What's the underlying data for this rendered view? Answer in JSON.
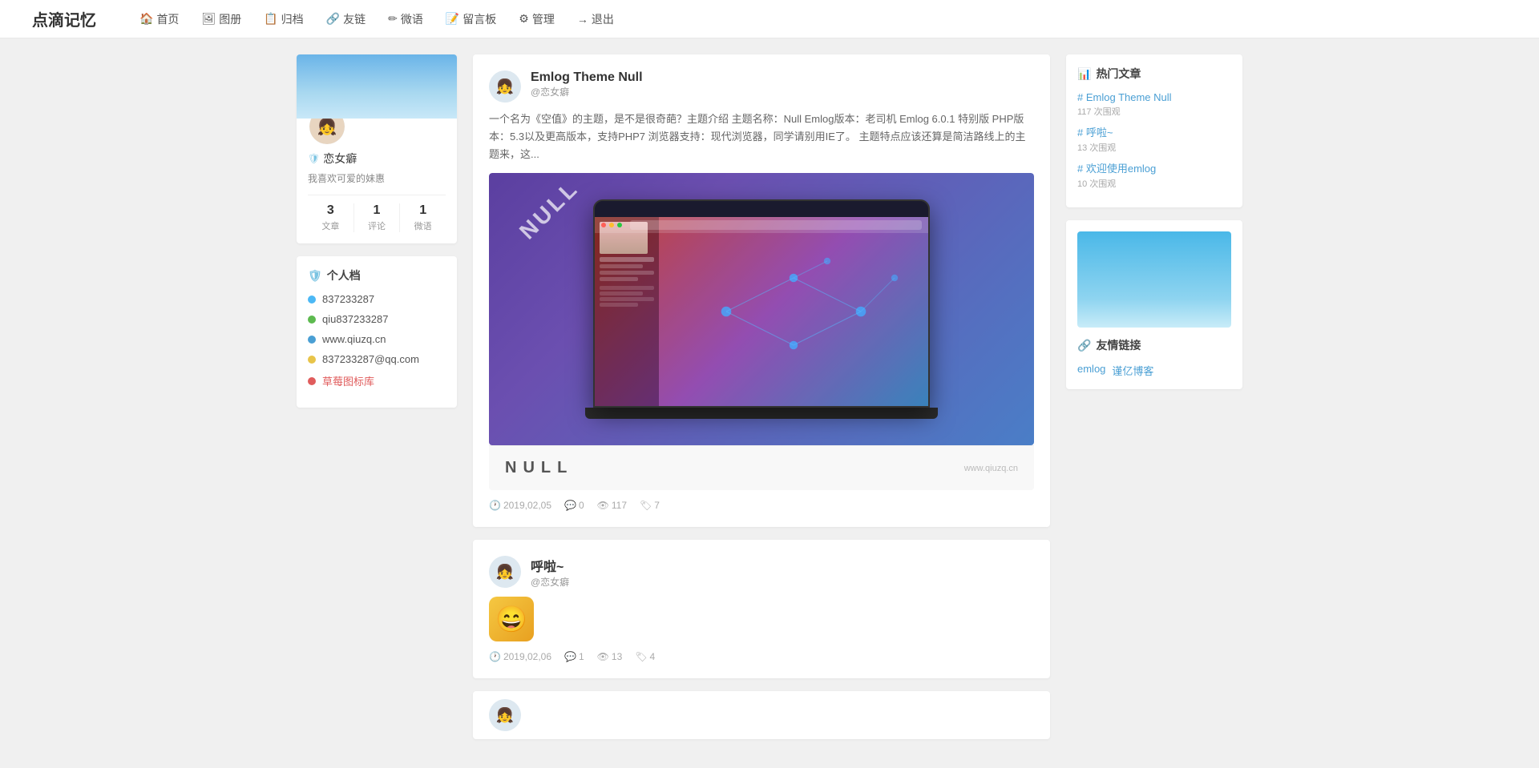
{
  "brand": "点滴记忆",
  "nav": {
    "items": [
      {
        "label": "首页",
        "icon": "🏠",
        "href": "#"
      },
      {
        "label": "图册",
        "icon": "🖼",
        "href": "#"
      },
      {
        "label": "归档",
        "icon": "📋",
        "href": "#"
      },
      {
        "label": "友链",
        "icon": "🔗",
        "href": "#"
      },
      {
        "label": "微语",
        "icon": "✏",
        "href": "#"
      },
      {
        "label": "留言板",
        "icon": "📝",
        "href": "#"
      },
      {
        "label": "管理",
        "icon": "⚙",
        "href": "#"
      },
      {
        "label": "退出",
        "icon": "→",
        "href": "#"
      }
    ]
  },
  "profile": {
    "name": "恋女癖",
    "desc": "我喜欢可爱的妹惠",
    "stats": [
      {
        "num": "3",
        "label": "文章"
      },
      {
        "num": "1",
        "label": "评论"
      },
      {
        "num": "1",
        "label": "微语"
      }
    ]
  },
  "personal": {
    "title": "个人档",
    "items": [
      {
        "type": "qq",
        "text": "837233287"
      },
      {
        "type": "wechat",
        "text": "qiu837233287"
      },
      {
        "type": "home",
        "text": "www.qiuzq.cn"
      },
      {
        "type": "email",
        "text": "837233287@qq.com"
      },
      {
        "type": "link",
        "text": "草莓图标库"
      }
    ]
  },
  "articles": [
    {
      "id": 1,
      "title": "Emlog Theme Null",
      "author": "@恋女癖",
      "excerpt": "一个名为《空值》的主题，是不是很奇葩？主题介绍 主题名称：Null Emlog版本：老司机 Emlog 6.0.1 特别版 PHP版本：5.3以及更高版本，支持PHP7 浏览器支持：现代浏览器，同学请别用IE了。 主题特点应该还算是简洁路线上的主题来，这...",
      "date": "2019,02,05",
      "comments": "0",
      "views": "117",
      "tags": "7",
      "hasImage": true,
      "nullLabel": "NULL",
      "watermark": "www.qiuzq.cn"
    },
    {
      "id": 2,
      "title": "呼啦~",
      "author": "@恋女癖",
      "excerpt": "",
      "date": "2019,02,06",
      "comments": "1",
      "views": "13",
      "tags": "4",
      "hasImage": false,
      "hasEmoji": true
    }
  ],
  "hot_articles": {
    "title": "热门文章",
    "items": [
      {
        "label": "# Emlog Theme Null",
        "views": "117 次围观"
      },
      {
        "label": "# 呼啦~",
        "views": "13 次围观"
      },
      {
        "label": "# 欢迎使用emlog",
        "views": "10 次围观"
      }
    ]
  },
  "friend_links": {
    "title": "友情链接",
    "items": [
      {
        "label": "emlog"
      },
      {
        "label": "谨亿博客"
      }
    ]
  }
}
